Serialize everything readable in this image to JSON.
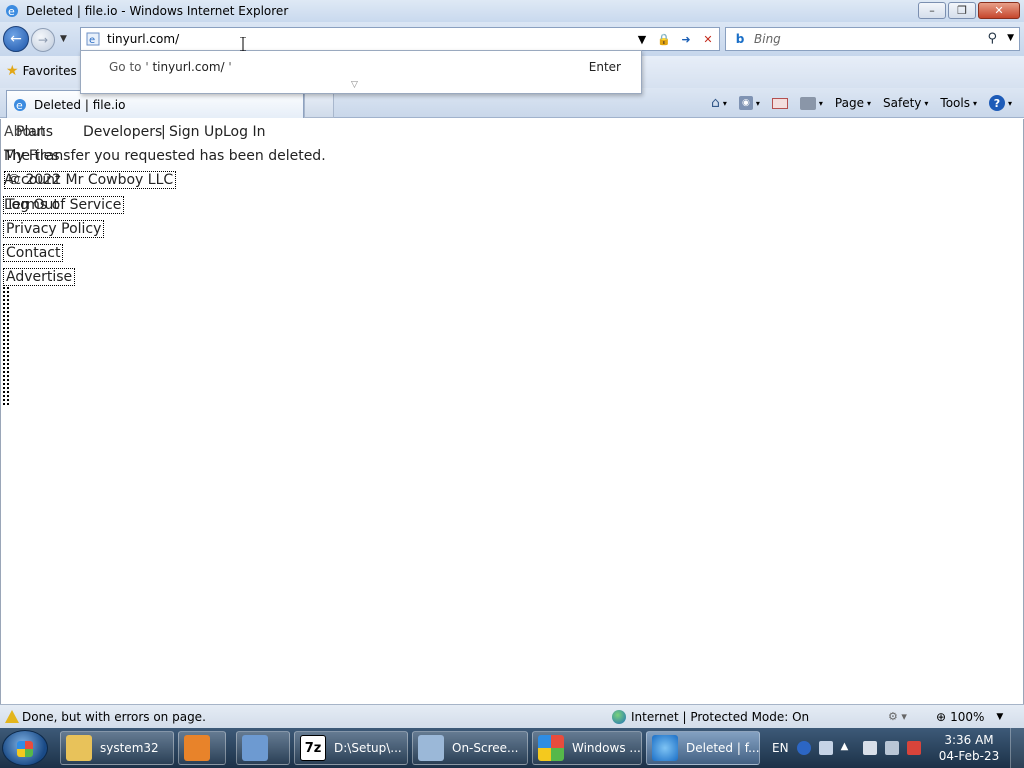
{
  "window": {
    "title": "Deleted | file.io - Windows Internet Explorer",
    "controls": {
      "minimize": "–",
      "restore": "❐",
      "close": "✕"
    }
  },
  "nav": {
    "back_icon": "←",
    "forward_icon": "→",
    "dropdown": "▼",
    "address_value": "tinyurl.com/",
    "go_icon": "➜",
    "stop_icon": "✕",
    "lock_icon": "🔒",
    "search_placeholder": "Bing",
    "search_glyph": "⚲",
    "bing_glyph": "b"
  },
  "autocomplete": {
    "goto_prefix": "Go to '",
    "goto_url": " tinyurl.com/",
    "goto_suffix": " '",
    "enter_label": "Enter",
    "grip": "▽"
  },
  "favorites": {
    "label": "Favorites"
  },
  "tab": {
    "label": "Deleted | file.io"
  },
  "commandbar": {
    "page": "Page",
    "safety": "Safety",
    "tools": "Tools",
    "caret": "▾",
    "help": "?"
  },
  "content": {
    "nav_links": [
      "Plans",
      "Developers",
      "|",
      "Sign Up",
      "Log In"
    ],
    "nav_links_under": [
      "About",
      "Developers"
    ],
    "message": "The transfer you requested has been deleted.",
    "message_under": "My Files",
    "copyright": "© 2022 Mr Cowboy LLC",
    "copyright_under": "Account",
    "footer": [
      "Terms of Service",
      "Privacy Policy",
      "Contact",
      "Advertise"
    ],
    "footer_under": "Log Out"
  },
  "status": {
    "text": "Done, but with errors on page.",
    "zone": "Internet | Protected Mode: On",
    "zoom": "100%",
    "zoom_caret": "▼"
  },
  "taskbar": {
    "items": [
      {
        "label": "system32"
      },
      {
        "label": ""
      },
      {
        "label": ""
      },
      {
        "label": "D:\\Setup\\..."
      },
      {
        "label": "On-Scree..."
      },
      {
        "label": "Windows ..."
      },
      {
        "label": "Deleted | f..."
      }
    ],
    "lang": "EN",
    "time": "3:36 AM",
    "date": "04-Feb-23"
  }
}
